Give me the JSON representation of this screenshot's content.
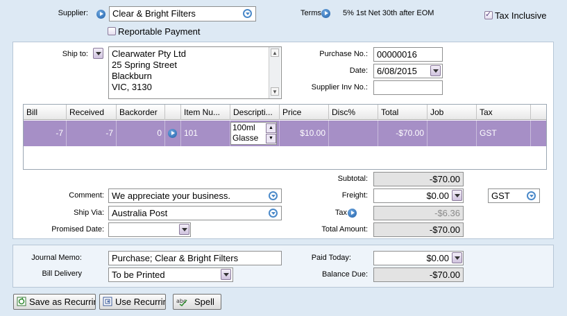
{
  "top": {
    "supplier_label": "Supplier:",
    "supplier_value": "Clear & Bright Filters",
    "terms_label": "Terms",
    "terms_value": "5% 1st Net 30th after EOM",
    "reportable_label": "Reportable Payment",
    "reportable_checked": false,
    "tax_inclusive_label": "Tax Inclusive",
    "tax_inclusive_checked": true
  },
  "ship": {
    "ship_to_label": "Ship to:",
    "address_line1": "Clearwater Pty Ltd",
    "address_line2": "25 Spring Street",
    "address_line3": "Blackburn",
    "address_line4": "VIC, 3130",
    "purchase_no_label": "Purchase No.:",
    "purchase_no_value": "00000016",
    "date_label": "Date:",
    "date_value": "6/08/2015",
    "supplier_inv_label": "Supplier Inv No.:",
    "supplier_inv_value": ""
  },
  "grid": {
    "columns": [
      "Bill",
      "Received",
      "Backorder",
      "",
      "Item Nu...",
      "Descripti...",
      "Price",
      "Disc%",
      "Total",
      "Job",
      "Tax"
    ],
    "rows": [
      {
        "bill": "-7",
        "received": "-7",
        "backorder": "0",
        "item_no": "101",
        "description_line1": "100ml",
        "description_line2": "Glasse",
        "price": "$10.00",
        "disc": "",
        "total": "-$70.00",
        "job": "",
        "tax": "GST"
      }
    ]
  },
  "footer": {
    "comment_label": "Comment:",
    "comment_value": "We appreciate your business.",
    "ship_via_label": "Ship Via:",
    "ship_via_value": "Australia Post",
    "promised_date_label": "Promised Date:",
    "promised_date_value": "",
    "subtotal_label": "Subtotal:",
    "subtotal_value": "-$70.00",
    "freight_label": "Freight:",
    "freight_value": "$0.00",
    "freight_tax_code": "GST",
    "tax_label": "Tax",
    "tax_value": "-$6.36",
    "total_label": "Total Amount:",
    "total_value": "-$70.00"
  },
  "bottom": {
    "journal_memo_label": "Journal Memo:",
    "journal_memo_value": "Purchase; Clear & Bright Filters",
    "bill_delivery_label": "Bill Delivery",
    "bill_delivery_value": "To be Printed",
    "paid_today_label": "Paid Today:",
    "paid_today_value": "$0.00",
    "balance_due_label": "Balance Due:",
    "balance_due_value": "-$70.00"
  },
  "buttons": {
    "save_recurring": "Save as Recurring",
    "use_recurring": "Use Recurring",
    "spell": "Spell"
  },
  "colors": {
    "selected_row": "#a68fc6",
    "background": "#dde9f4",
    "accent_blue": "#4a89c9"
  }
}
